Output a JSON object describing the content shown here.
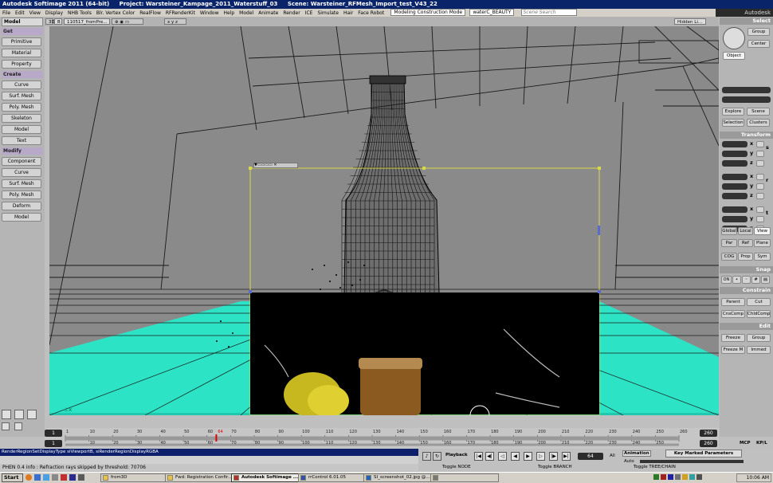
{
  "title": {
    "app": "Autodesk Softimage 2011 (64-bit)",
    "project": "Project: Warsteiner_Kampage_2011_Waterstuff_03",
    "scene": "Scene: Warsteiner_RFMesh_Import_test_V43_22"
  },
  "menu": {
    "items": [
      "File",
      "Edit",
      "View",
      "Display",
      "NHB Tools",
      "Blr. Vertex Color",
      "RealFlow",
      "RFRenderKit",
      "Window",
      "Help",
      "Model",
      "Animate",
      "Render",
      "ICE",
      "Simulate",
      "Hair",
      "Face Robot"
    ],
    "construction_mode": "Modeling Construction Mode",
    "pass": "waterC_BEAUTY",
    "search_placeholder": "Scene Search",
    "brand": "Autodesk Softimage"
  },
  "left_toolbar": {
    "mode": "Model",
    "sections": [
      {
        "title": "Get",
        "buttons": [
          "Primitive",
          "Material",
          "Property"
        ]
      },
      {
        "title": "Create",
        "buttons": [
          "Curve",
          "Surf. Mesh",
          "Poly. Mesh",
          "Skeleton",
          "Model",
          "Text"
        ]
      },
      {
        "title": "Modify",
        "buttons": [
          "Component",
          "Curve",
          "Surf. Mesh",
          "Poly. Mesh",
          "Deform",
          "Model"
        ]
      }
    ]
  },
  "viewport": {
    "camera_label": "B",
    "camera_name": "110517_fromPre...",
    "hidden_label": "Hidden Li...",
    "axes_label": "x y z",
    "letter": "3D",
    "region_title": "▼▭▭▭▭ ✕",
    "colors": {
      "background": "#8a8a8a",
      "water": "#2de3c6",
      "wire": "#1a1a1a",
      "region": "#d8d84a"
    }
  },
  "right_panel": {
    "select_title": "Select",
    "select_buttons": [
      "Group",
      "Center"
    ],
    "object_label": "Object",
    "explore_buttons": [
      "Explore",
      "Scene",
      "Selection",
      "Clusters"
    ],
    "transform_title": "Transform",
    "axis_labels": [
      "x",
      "y",
      "z",
      "x",
      "y",
      "z",
      "x",
      "y",
      "z"
    ],
    "side_letters": [
      "s",
      "r",
      "t"
    ],
    "ref_buttons": [
      "Global",
      "Local",
      "View",
      "Par",
      "Ref",
      "Plane",
      "COG",
      "Prop",
      "Sym"
    ],
    "snap_title": "Snap",
    "snap_on": "ON",
    "constrain_title": "Constrain",
    "constrain_buttons": [
      "Parent",
      "Cut",
      "CnsComp",
      "ChldComp"
    ],
    "edit_title": "Edit",
    "edit_buttons": [
      "Freeze",
      "Group",
      "Freeze M",
      "Immed"
    ],
    "bottom_labels": [
      "MCP",
      "KP/L"
    ]
  },
  "timeline": {
    "start_frame": "1",
    "end_frame": "260",
    "current_frame": "64",
    "start_frame2": "1",
    "end_frame2": "260",
    "ticks": [
      "1",
      "10",
      "20",
      "30",
      "40",
      "50",
      "60",
      "70",
      "80",
      "90",
      "100",
      "110",
      "120",
      "130",
      "140",
      "150",
      "160",
      "170",
      "180",
      "190",
      "200",
      "210",
      "220",
      "230",
      "240",
      "250",
      "260"
    ],
    "ticks2": [
      "10",
      "20",
      "30",
      "40",
      "50",
      "60",
      "70",
      "80",
      "90",
      "100",
      "110",
      "120",
      "130",
      "140",
      "150",
      "160",
      "170",
      "180",
      "190",
      "200",
      "210",
      "220",
      "230",
      "240",
      "250"
    ],
    "current_fraction": 0.246
  },
  "command_line": "RenderRegionSetDisplayType siViewportB, siRenderRegionDisplayRGBA",
  "status_line": "PHEN 0.4  info : Refraction rays skipped by threshold: 70706",
  "playback": {
    "label": "Playback",
    "frame_value": "64",
    "all_label": "All",
    "animation_label": "Animation",
    "key_label": "Key Marked Parameters",
    "auto_label": "Auto",
    "toggle_node": "Toggle NODE",
    "toggle_branch": "Toggle BRANCH",
    "toggle_tree": "Toggle TREE/CHAIN"
  },
  "taskbar": {
    "start": "Start",
    "tasks": [
      "from3D",
      "Fwd: Registration Confir...",
      "Autodesk Softimage ...",
      "rrControl   6.01.05",
      "SI_screenshot_02.jpg @...",
      ""
    ],
    "active_index": 2,
    "clock": "10:06 AM"
  }
}
